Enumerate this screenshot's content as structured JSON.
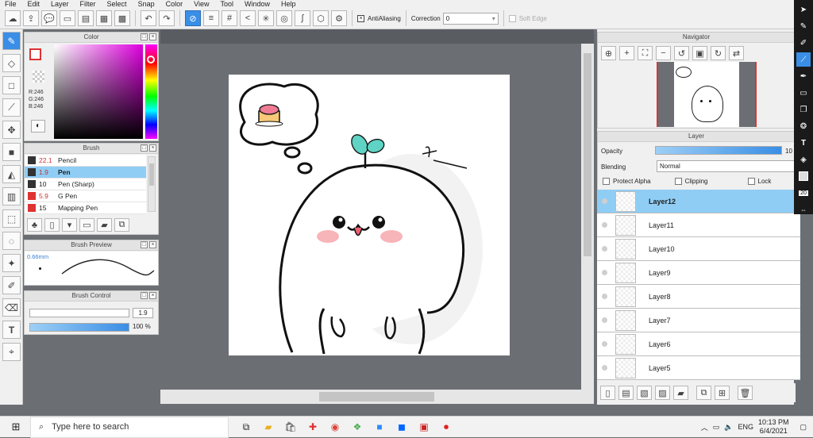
{
  "menu": [
    "File",
    "Edit",
    "Layer",
    "Filter",
    "Select",
    "Snap",
    "Color",
    "View",
    "Tool",
    "Window",
    "Help"
  ],
  "toolbar": {
    "antialiasing": "AntiAliasing",
    "correction_label": "Correction",
    "correction_value": "0",
    "soft_edge": "Soft Edge"
  },
  "color_panel": {
    "title": "Color",
    "r": "R:246",
    "g": "G:246",
    "b": "B:246"
  },
  "brush_panel": {
    "title": "Brush",
    "items": [
      {
        "size": "22.1",
        "name": "Pencil"
      },
      {
        "size": "1.9",
        "name": "Pen"
      },
      {
        "size": "10",
        "name": "Pen (Sharp)"
      },
      {
        "size": "5.9",
        "name": "G Pen"
      },
      {
        "size": "15",
        "name": "Mapping Pen"
      }
    ]
  },
  "brush_preview": {
    "title": "Brush Preview",
    "size": "0.66mm"
  },
  "brush_control": {
    "title": "Brush Control",
    "size_value": "1.9",
    "opacity_value": "100 %",
    "opacity_level": 1.0
  },
  "navigator": {
    "title": "Navigator"
  },
  "layer_panel": {
    "title": "Layer",
    "opacity_label": "Opacity",
    "opacity_value": "10",
    "blending_label": "Blending",
    "blending_value": "Normal",
    "protect_alpha": "Protect Alpha",
    "clipping": "Clipping",
    "lock": "Lock",
    "layers": [
      "Layer12",
      "Layer11",
      "Layer10",
      "Layer9",
      "Layer8",
      "Layer7",
      "Layer6",
      "Layer5"
    ]
  },
  "right_tools": {
    "size_value": "20"
  },
  "taskbar": {
    "search_placeholder": "Type here to search",
    "lang": "ENG",
    "time": "10:13 PM",
    "date": "6/4/2021"
  },
  "colors": {
    "accent": "#3a8ee6",
    "selected_row": "#8fcdf5",
    "canvas_bg": "#6b6f73"
  }
}
